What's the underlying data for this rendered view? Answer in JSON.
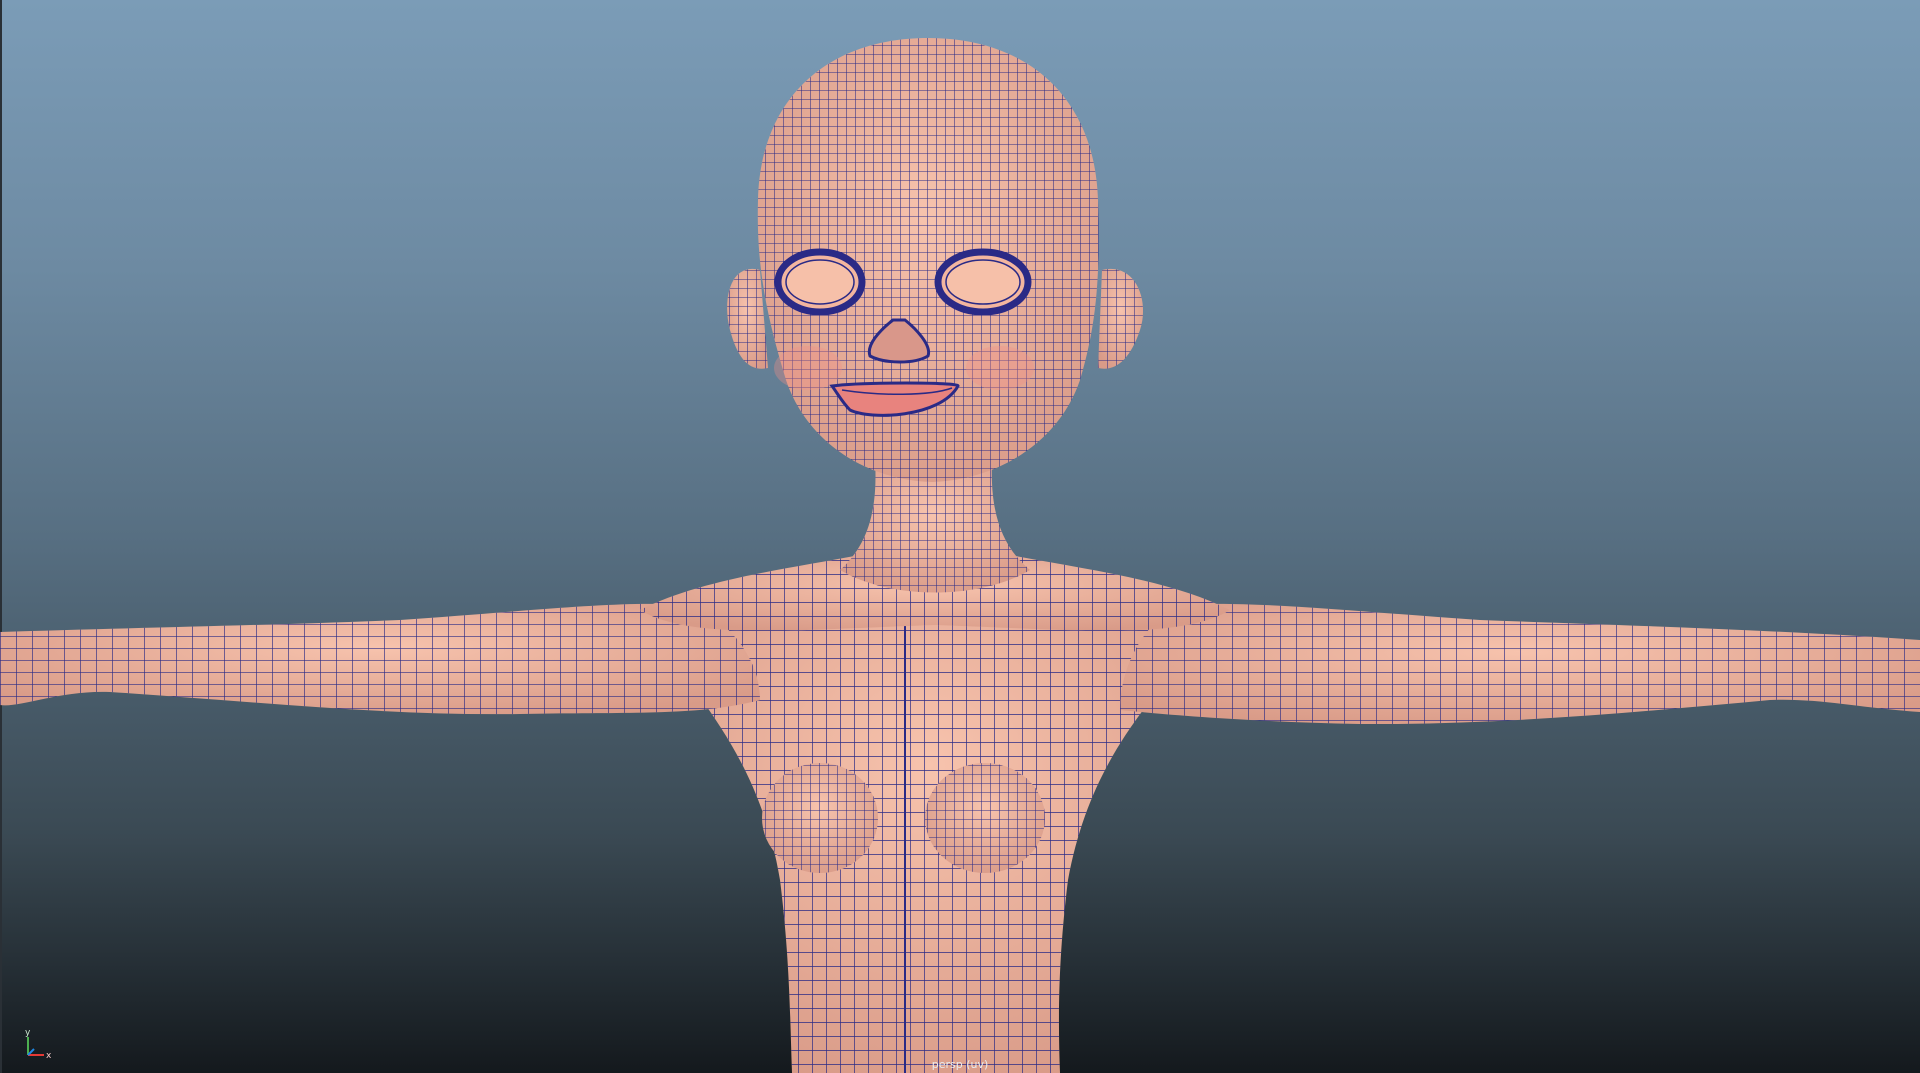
{
  "viewport": {
    "camera_label": "persp (uv)",
    "background_top": "#7b9cb7",
    "background_bottom": "#14191d"
  },
  "model": {
    "skin_color": "#f4b9a3",
    "wire_color": "#2a2a86",
    "lip_color": "#e8837e"
  },
  "axis": {
    "y": "y",
    "x": "x"
  }
}
